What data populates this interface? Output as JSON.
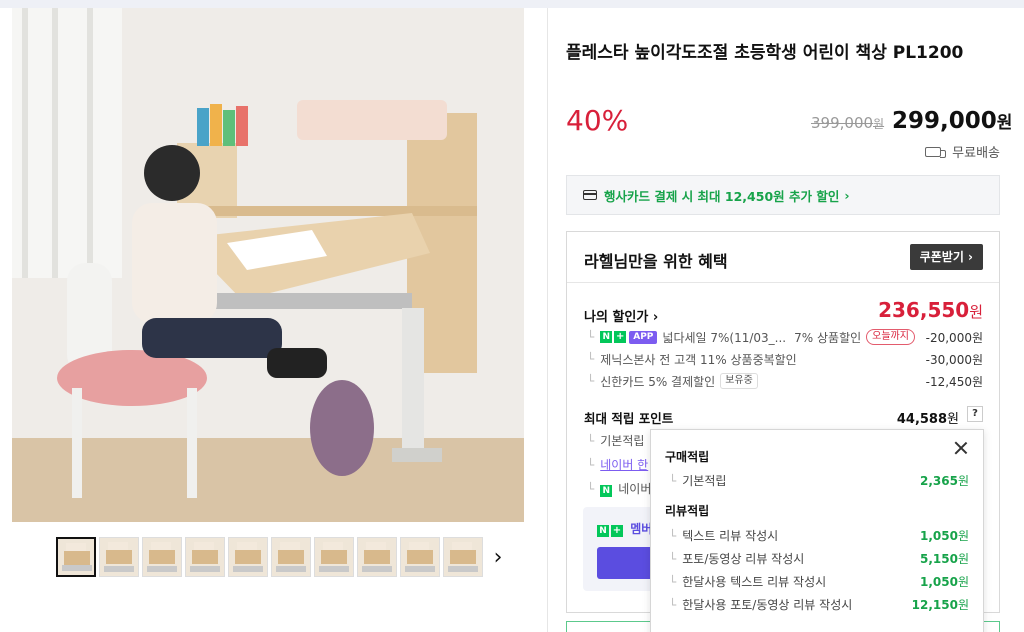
{
  "product": {
    "title": "플레스타 높이각도조절 초등학생 어린이 책상 PL1200",
    "discount": "40%",
    "original_price": "399,000",
    "original_price_unit": "원",
    "price": "299,000",
    "price_unit": "원",
    "shipping": "무료배송"
  },
  "gallery": {
    "thumbnail_count": 10,
    "next_label": "›"
  },
  "card_banner": {
    "text": "행사카드 결제 시 최대 12,450원 추가 할인",
    "chevron": "›"
  },
  "benefits": {
    "title": "라헬님만을 위한 혜택",
    "coupon_button": "쿠폰받기 ›",
    "my_discount_label": "나의 할인가 ›",
    "my_discount_price": "236,550",
    "my_discount_unit": "원",
    "rows": [
      {
        "badges": [
          "N",
          "+",
          "APP"
        ],
        "text": "넓다세일 7%(11/03_...",
        "extra": "7% 상품할인",
        "pill": "오늘까지",
        "amount": "-20,000원"
      },
      {
        "text": "제닉스본사 전 고객 11% 상품중복할인",
        "amount": "-30,000원"
      },
      {
        "text": "신한카드 5% 결제할인",
        "pill": "보유중",
        "amount": "-12,450원"
      }
    ],
    "points_label": "최대 적립 포인트",
    "points_value": "44,588",
    "points_unit": "원",
    "help": "?",
    "point_rows": [
      {
        "text": "기본적립"
      },
      {
        "text": "네이버 한"
      },
      {
        "text": "네이버"
      }
    ],
    "member_text": "멤버"
  },
  "popover": {
    "section1_title": "구매적립",
    "section1_rows": [
      {
        "label": "기본적립",
        "amount": "2,365"
      }
    ],
    "section2_title": "리뷰적립",
    "section2_rows": [
      {
        "label": "텍스트 리뷰 작성시",
        "amount": "1,050"
      },
      {
        "label": "포토/동영상 리뷰 작성시",
        "amount": "5,150"
      },
      {
        "label": "한달사용 텍스트 리뷰 작성시",
        "amount": "1,050"
      },
      {
        "label": "한달사용 포토/동영상 리뷰 작성시",
        "amount": "12,150"
      }
    ],
    "unit": "원"
  },
  "colors": {
    "discount_red": "#d8203a",
    "green": "#17a34a",
    "naver_green": "#03c75a",
    "purple": "#7c5cf0"
  }
}
